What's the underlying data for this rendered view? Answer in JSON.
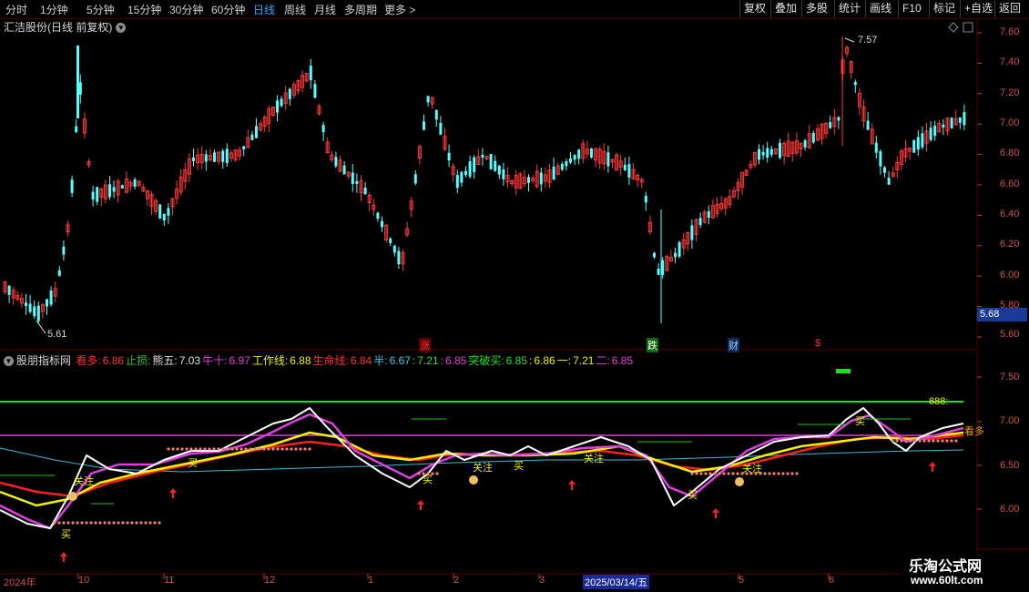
{
  "toolbar": {
    "periods": [
      "分时",
      "1分钟",
      "5分钟",
      "15分钟",
      "30分钟",
      "60分钟",
      "日线",
      "周线",
      "月线",
      "多周期",
      "更多 >"
    ],
    "active_period": "日线",
    "buttons": [
      "复权",
      "叠加",
      "多股",
      "统计",
      "画线",
      "F10",
      "标记",
      "+自选",
      "返回"
    ]
  },
  "main_panel": {
    "title": "汇洁股份(日线 前复权)",
    "price_axis": [
      "7.60",
      "7.40",
      "7.20",
      "7.00",
      "6.80",
      "6.60",
      "6.40",
      "6.20",
      "6.00",
      "5.80",
      "5.60"
    ],
    "high_label": "7.57",
    "low_label": "5.61",
    "current_price": "5.68",
    "event_markers": [
      {
        "text": "涨",
        "color": "#ff3030",
        "bg": "#5a0000"
      },
      {
        "text": "跌",
        "color": "#ffffff",
        "bg": "#0a6a0a"
      },
      {
        "text": "财",
        "color": "#9fd0ff",
        "bg": "#0a2a5a"
      },
      {
        "text": "$",
        "color": "#ff3030",
        "bg": "#000000"
      }
    ]
  },
  "indicator_panel": {
    "name": "股朋指标网",
    "items": [
      {
        "label": "看多:",
        "value": "6.86",
        "color": "#ff3030"
      },
      {
        "label": "止损:",
        "value": "",
        "color": "#28c828"
      },
      {
        "label": "熊五:",
        "value": "7.03",
        "color": "#e0e0e0"
      },
      {
        "label": "牛十:",
        "value": "6.97",
        "color": "#e040e0"
      },
      {
        "label": "工作线:",
        "value": "6.88",
        "color": "#f0f000"
      },
      {
        "label": "生命线:",
        "value": "6.84",
        "color": "#ff3030"
      },
      {
        "label": "半:",
        "value": "6.67",
        "color": "#40c8e0"
      },
      {
        "label": ":",
        "value": "7.21",
        "color": "#28e028"
      },
      {
        "label": ":",
        "value": "6.85",
        "color": "#e040e0"
      },
      {
        "label": "突破买:",
        "value": "6.85",
        "color": "#28e028"
      },
      {
        "label": ":",
        "value": "6.86",
        "color": "#f0f000"
      },
      {
        "label": "一:",
        "value": "7.21",
        "color": "#f0f000"
      },
      {
        "label": "二:",
        "value": "6.85",
        "color": "#e040e0"
      }
    ],
    "axis": [
      "7.50",
      "7.00",
      "6.50",
      "6.00"
    ],
    "level_label": "888:",
    "signals": [
      "关注",
      "买",
      "关注",
      "买",
      "买",
      "关注",
      "买",
      "关注",
      "买",
      "买",
      "看多"
    ]
  },
  "date_axis": [
    "2024年",
    "10",
    "11",
    "12",
    "1",
    "2",
    "3",
    "2025/03/14/五",
    "5",
    "6"
  ],
  "watermark": {
    "line1": "乐淘公式网",
    "line2": "www.60lt.com"
  },
  "colors": {
    "up": "#ff3838",
    "down": "#54ffff",
    "grid": "#5a0000",
    "white_line": "#ffffff",
    "magenta_line": "#e040e0",
    "yellow_line": "#f0f000",
    "red_line": "#ff2020",
    "cyan_line": "#40b8d8"
  }
}
